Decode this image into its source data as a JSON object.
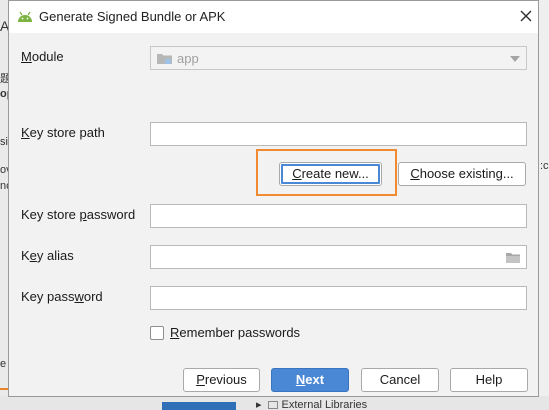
{
  "background": {
    "left_fragments": [
      "A",
      "题",
      "op",
      "si",
      "ov",
      "nc",
      "e"
    ],
    "right_fragments": [
      ":c"
    ],
    "external_libraries_label": "External Libraries"
  },
  "dialog": {
    "title": "Generate Signed Bundle or APK",
    "close_icon": "close-icon"
  },
  "module": {
    "label_prefix": "",
    "label_u": "M",
    "label_rest": "odule",
    "value": "app"
  },
  "key_store_path": {
    "label_prefix": "",
    "label_u": "K",
    "label_rest": "ey store path",
    "value": ""
  },
  "buttons": {
    "create_new": {
      "u": "C",
      "rest": "reate new..."
    },
    "choose_existing": {
      "u": "C",
      "rest": "hoose existing..."
    },
    "previous": {
      "u": "P",
      "rest": "revious"
    },
    "next": {
      "u": "N",
      "rest": "ext"
    },
    "cancel": "Cancel",
    "help": "Help"
  },
  "key_store_password": {
    "label_prefix": "Key store ",
    "label_u": "p",
    "label_rest": "assword",
    "value": ""
  },
  "key_alias": {
    "label_prefix": "K",
    "label_u": "e",
    "label_rest": "y alias",
    "value": ""
  },
  "key_password": {
    "label_prefix": "Key pass",
    "label_u": "w",
    "label_rest": "ord",
    "value": ""
  },
  "remember": {
    "u": "R",
    "rest": "emember passwords",
    "checked": false
  },
  "colors": {
    "accent": "#4a87d4",
    "highlight": "#f08b32",
    "android": "#7cb342"
  }
}
